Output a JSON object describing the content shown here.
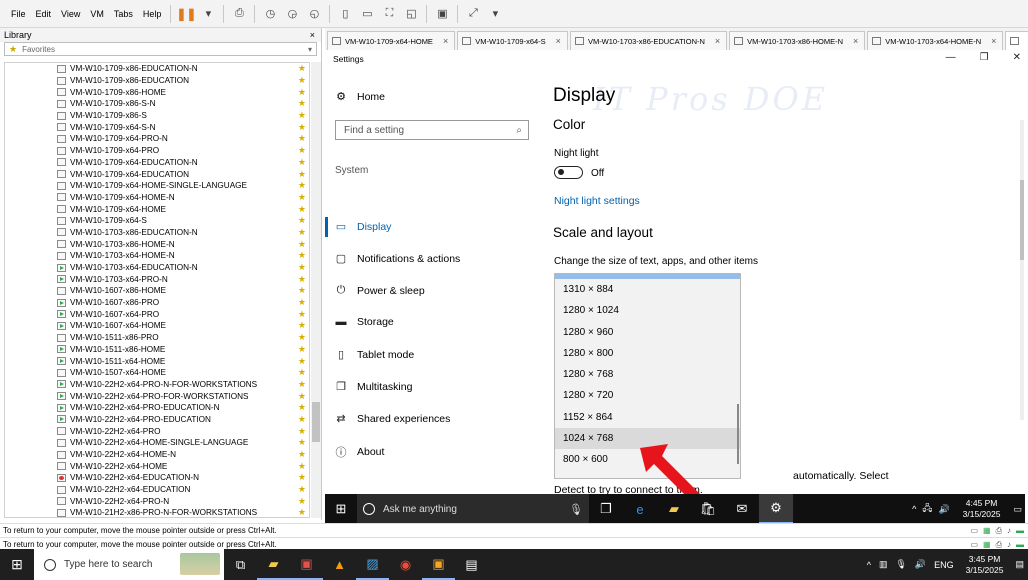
{
  "menubar": {
    "items": [
      "File",
      "Edit",
      "View",
      "VM",
      "Tabs",
      "Help"
    ]
  },
  "library": {
    "title": "Library",
    "close": "×",
    "search_placeholder": "Favorites",
    "vms": [
      {
        "name": "VM-W10-1709-x86-EDUCATION-N",
        "state": "off"
      },
      {
        "name": "VM-W10-1709-x86-EDUCATION",
        "state": "off"
      },
      {
        "name": "VM-W10-1709-x86-HOME",
        "state": "off"
      },
      {
        "name": "VM-W10-1709-x86-S-N",
        "state": "off"
      },
      {
        "name": "VM-W10-1709-x86-S",
        "state": "off"
      },
      {
        "name": "VM-W10-1709-x64-S-N",
        "state": "off"
      },
      {
        "name": "VM-W10-1709-x64-PRO-N",
        "state": "off"
      },
      {
        "name": "VM-W10-1709-x64-PRO",
        "state": "off"
      },
      {
        "name": "VM-W10-1709-x64-EDUCATION-N",
        "state": "off"
      },
      {
        "name": "VM-W10-1709-x64-EDUCATION",
        "state": "off"
      },
      {
        "name": "VM-W10-1709-x64-HOME-SINGLE-LANGUAGE",
        "state": "off"
      },
      {
        "name": "VM-W10-1709-x64-HOME-N",
        "state": "off"
      },
      {
        "name": "VM-W10-1709-x64-HOME",
        "state": "off"
      },
      {
        "name": "VM-W10-1709-x64-S",
        "state": "off"
      },
      {
        "name": "VM-W10-1703-x86-EDUCATION-N",
        "state": "off"
      },
      {
        "name": "VM-W10-1703-x86-HOME-N",
        "state": "off"
      },
      {
        "name": "VM-W10-1703-x64-HOME-N",
        "state": "off"
      },
      {
        "name": "VM-W10-1703-x64-EDUCATION-N",
        "state": "running"
      },
      {
        "name": "VM-W10-1703-x64-PRO-N",
        "state": "running"
      },
      {
        "name": "VM-W10-1607-x86-HOME",
        "state": "off"
      },
      {
        "name": "VM-W10-1607-x86-PRO",
        "state": "running"
      },
      {
        "name": "VM-W10-1607-x64-PRO",
        "state": "running"
      },
      {
        "name": "VM-W10-1607-x64-HOME",
        "state": "running"
      },
      {
        "name": "VM-W10-1511-x86-PRO",
        "state": "off"
      },
      {
        "name": "VM-W10-1511-x86-HOME",
        "state": "running"
      },
      {
        "name": "VM-W10-1511-x64-HOME",
        "state": "running"
      },
      {
        "name": "VM-W10-1507-x64-HOME",
        "state": "off"
      },
      {
        "name": "VM-W10-22H2-x64-PRO-N-FOR-WORKSTATIONS",
        "state": "running"
      },
      {
        "name": "VM-W10-22H2-x64-PRO-FOR-WORKSTATIONS",
        "state": "running"
      },
      {
        "name": "VM-W10-22H2-x64-PRO-EDUCATION-N",
        "state": "running"
      },
      {
        "name": "VM-W10-22H2-x64-PRO-EDUCATION",
        "state": "running"
      },
      {
        "name": "VM-W10-22H2-x64-PRO",
        "state": "off"
      },
      {
        "name": "VM-W10-22H2-x64-HOME-SINGLE-LANGUAGE",
        "state": "off"
      },
      {
        "name": "VM-W10-22H2-x64-HOME-N",
        "state": "off"
      },
      {
        "name": "VM-W10-22H2-x64-HOME",
        "state": "off"
      },
      {
        "name": "VM-W10-22H2-x64-EDUCATION-N",
        "state": "suspended"
      },
      {
        "name": "VM-W10-22H2-x64-EDUCATION",
        "state": "off"
      },
      {
        "name": "VM-W10-22H2-x64-PRO-N",
        "state": "off"
      },
      {
        "name": "VM-W10-21H2-x86-PRO-N-FOR-WORKSTATIONS",
        "state": "off"
      }
    ]
  },
  "vmtabs": [
    {
      "label": "VM-W10-1709-x64-HOME",
      "active": false
    },
    {
      "label": "VM-W10-1709-x64-S",
      "active": false
    },
    {
      "label": "VM-W10-1703-x86-EDUCATION-N",
      "active": false
    },
    {
      "label": "VM-W10-1703-x86-HOME-N",
      "active": false
    },
    {
      "label": "VM-W10-1703-x64-HOME-N",
      "active": false
    }
  ],
  "settings": {
    "window_title": "Settings",
    "home": "Home",
    "search_placeholder": "Find a setting",
    "section_label": "System",
    "nav": [
      {
        "label": "Display",
        "icon": "monitor-icon",
        "glyph": "▭",
        "active": true
      },
      {
        "label": "Notifications & actions",
        "icon": "notifications-icon",
        "glyph": "▢",
        "active": false
      },
      {
        "label": "Power & sleep",
        "icon": "power-icon",
        "glyph": "⏻",
        "active": false
      },
      {
        "label": "Storage",
        "icon": "storage-icon",
        "glyph": "▬",
        "active": false
      },
      {
        "label": "Tablet mode",
        "icon": "tablet-icon",
        "glyph": "▯",
        "active": false
      },
      {
        "label": "Multitasking",
        "icon": "multitasking-icon",
        "glyph": "❐",
        "active": false
      },
      {
        "label": "Shared experiences",
        "icon": "shared-icon",
        "glyph": "⇄",
        "active": false
      },
      {
        "label": "About",
        "icon": "info-icon",
        "glyph": "ⓘ",
        "active": false
      }
    ],
    "page_title": "Display",
    "color_heading": "Color",
    "night_light_label": "Night light",
    "night_light_state": "Off",
    "night_light_link": "Night light settings",
    "scale_heading": "Scale and layout",
    "scale_desc": "Change the size of text, apps, and other items",
    "partial_text_1": "automatically. Select",
    "partial_text_2": "Detect to try to connect to them.",
    "watermark": "IT Pros DOE",
    "resolutions": [
      "1310 × 884",
      "1280 × 1024",
      "1280 × 960",
      "1280 × 800",
      "1280 × 768",
      "1280 × 720",
      "1152 × 864",
      "1024 × 768",
      "800 × 600"
    ],
    "hovered_resolution": "1024 × 768"
  },
  "vm_taskbar": {
    "search_placeholder": "Ask me anything",
    "time": "4:45 PM",
    "date": "3/15/2025"
  },
  "status": {
    "line1": "To return to your computer, move the mouse pointer outside or press Ctrl+Alt.",
    "line2": "To return to your computer, move the mouse pointer outside or press Ctrl+Alt."
  },
  "host_taskbar": {
    "search_placeholder": "Type here to search",
    "lang": "ENG",
    "time": "3:45 PM",
    "date": "3/15/2025"
  }
}
